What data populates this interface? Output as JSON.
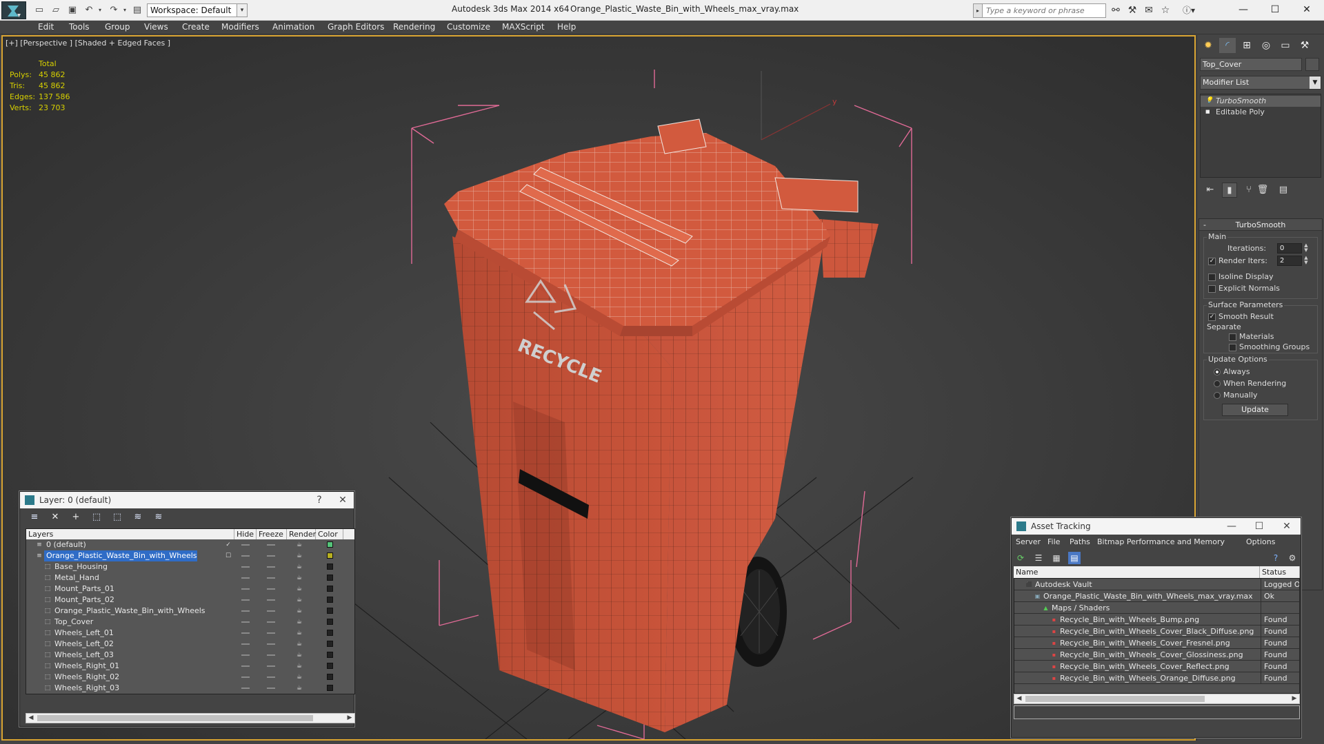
{
  "titlebar": {
    "app_title": "Autodesk 3ds Max  2014 x64",
    "file_title": "Orange_Plastic_Waste_Bin_with_Wheels_max_vray.max",
    "workspace_label": "Workspace: Default",
    "search_placeholder": "Type a keyword or phrase"
  },
  "menu": [
    "Edit",
    "Tools",
    "Group",
    "Views",
    "Create",
    "Modifiers",
    "Animation",
    "Graph Editors",
    "Rendering",
    "Customize",
    "MAXScript",
    "Help"
  ],
  "viewport": {
    "label": "[+] [Perspective ] [Shaded + Edged Faces ]",
    "stats": {
      "header": "Total",
      "rows": [
        {
          "label": "Polys:",
          "value": "45 862"
        },
        {
          "label": "Tris:",
          "value": "45 862"
        },
        {
          "label": "Edges:",
          "value": "137 586"
        },
        {
          "label": "Verts:",
          "value": "23 703"
        }
      ]
    },
    "gizmo_label": "y",
    "model_text": "RECYCLE",
    "colors": {
      "bin": "#c9543a",
      "lid": "#d25a3e",
      "bbox": "#e06a96",
      "border": "#d9a431"
    }
  },
  "command_panel": {
    "object_name": "Top_Cover",
    "modifier_list": "Modifier List",
    "stack": [
      "TurboSmooth",
      "Editable Poly"
    ],
    "rollout_title": "TurboSmooth",
    "main_group": "Main",
    "iterations_label": "Iterations:",
    "iterations_value": "0",
    "render_iters_label": "Render Iters:",
    "render_iters_value": "2",
    "isoline": "Isoline Display",
    "explicit": "Explicit Normals",
    "surface_group": "Surface Parameters",
    "smooth_result": "Smooth Result",
    "separate": "Separate",
    "materials": "Materials",
    "smoothing_groups": "Smoothing Groups",
    "update_group": "Update Options",
    "always": "Always",
    "when_rendering": "When Rendering",
    "manually": "Manually",
    "update_button": "Update"
  },
  "layer_manager": {
    "title": "Layer: 0 (default)",
    "help": "?",
    "columns": [
      "Layers",
      "Hide",
      "Freeze",
      "Render",
      "Color"
    ],
    "rows": [
      {
        "name": "0 (default)",
        "level": 1,
        "color": "#55c47a",
        "active": true
      },
      {
        "name": "Orange_Plastic_Waste_Bin_with_Wheels",
        "level": 1,
        "color": "#b8b020",
        "selected": true
      },
      {
        "name": "Base_Housing",
        "level": 2,
        "color": "#222222"
      },
      {
        "name": "Metal_Hand",
        "level": 2,
        "color": "#222222"
      },
      {
        "name": "Mount_Parts_01",
        "level": 2,
        "color": "#222222"
      },
      {
        "name": "Mount_Parts_02",
        "level": 2,
        "color": "#222222"
      },
      {
        "name": "Orange_Plastic_Waste_Bin_with_Wheels",
        "level": 2,
        "color": "#222222"
      },
      {
        "name": "Top_Cover",
        "level": 2,
        "color": "#222222"
      },
      {
        "name": "Wheels_Left_01",
        "level": 2,
        "color": "#222222"
      },
      {
        "name": "Wheels_Left_02",
        "level": 2,
        "color": "#222222"
      },
      {
        "name": "Wheels_Left_03",
        "level": 2,
        "color": "#222222"
      },
      {
        "name": "Wheels_Right_01",
        "level": 2,
        "color": "#222222"
      },
      {
        "name": "Wheels_Right_02",
        "level": 2,
        "color": "#222222"
      },
      {
        "name": "Wheels_Right_03",
        "level": 2,
        "color": "#222222"
      }
    ]
  },
  "asset_tracking": {
    "title": "Asset Tracking",
    "menu": [
      "Server",
      "File",
      "Paths",
      "Bitmap Performance and Memory",
      "Options"
    ],
    "columns": [
      "Name",
      "Status"
    ],
    "rows": [
      {
        "name": "Autodesk Vault",
        "status": "Logged O",
        "level": 1,
        "icon": "vault"
      },
      {
        "name": "Orange_Plastic_Waste_Bin_with_Wheels_max_vray.max",
        "status": "Ok",
        "level": 2,
        "icon": "max"
      },
      {
        "name": "Maps / Shaders",
        "status": "",
        "level": 3,
        "icon": "maps"
      },
      {
        "name": "Recycle_Bin_with_Wheels_Bump.png",
        "status": "Found",
        "level": 4,
        "icon": "png"
      },
      {
        "name": "Recycle_Bin_with_Wheels_Cover_Black_Diffuse.png",
        "status": "Found",
        "level": 4,
        "icon": "png"
      },
      {
        "name": "Recycle_Bin_with_Wheels_Cover_Fresnel.png",
        "status": "Found",
        "level": 4,
        "icon": "png"
      },
      {
        "name": "Recycle_Bin_with_Wheels_Cover_Glossiness.png",
        "status": "Found",
        "level": 4,
        "icon": "png"
      },
      {
        "name": "Recycle_Bin_with_Wheels_Cover_Reflect.png",
        "status": "Found",
        "level": 4,
        "icon": "png"
      },
      {
        "name": "Recycle_Bin_with_Wheels_Orange_Diffuse.png",
        "status": "Found",
        "level": 4,
        "icon": "png"
      }
    ]
  }
}
